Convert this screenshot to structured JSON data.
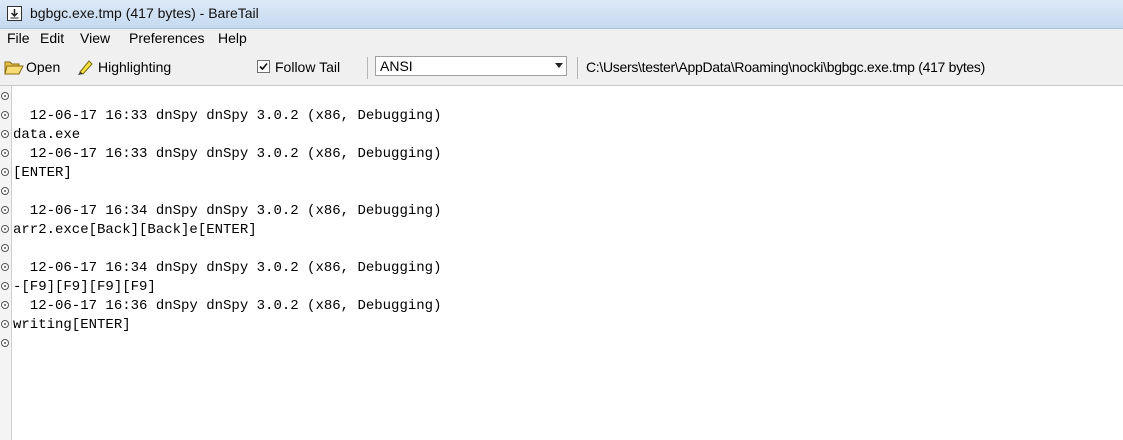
{
  "window": {
    "title": "bgbgc.exe.tmp (417 bytes) - BareTail"
  },
  "menu": [
    "File",
    "Edit",
    "View",
    "Preferences",
    "Help"
  ],
  "toolbar": {
    "open_label": "Open",
    "highlighting_label": "Highlighting",
    "follow_tail_label": "Follow Tail",
    "follow_tail_checked": true,
    "encoding_value": "ANSI",
    "file_path": "C:\\Users\\tester\\AppData\\Roaming\\nocki\\bgbgc.exe.tmp (417 bytes)"
  },
  "log_lines": [
    "",
    "  12-06-17 16:33 dnSpy dnSpy 3.0.2 (x86, Debugging)",
    "data.exe",
    "  12-06-17 16:33 dnSpy dnSpy 3.0.2 (x86, Debugging)",
    "[ENTER]",
    "",
    "  12-06-17 16:34 dnSpy dnSpy 3.0.2 (x86, Debugging)",
    "arr2.exce[Back][Back]e[ENTER]",
    "",
    "  12-06-17 16:34 dnSpy dnSpy 3.0.2 (x86, Debugging)",
    "-[F9][F9][F9][F9]",
    "  12-06-17 16:36 dnSpy dnSpy 3.0.2 (x86, Debugging)",
    "writing[ENTER]"
  ]
}
